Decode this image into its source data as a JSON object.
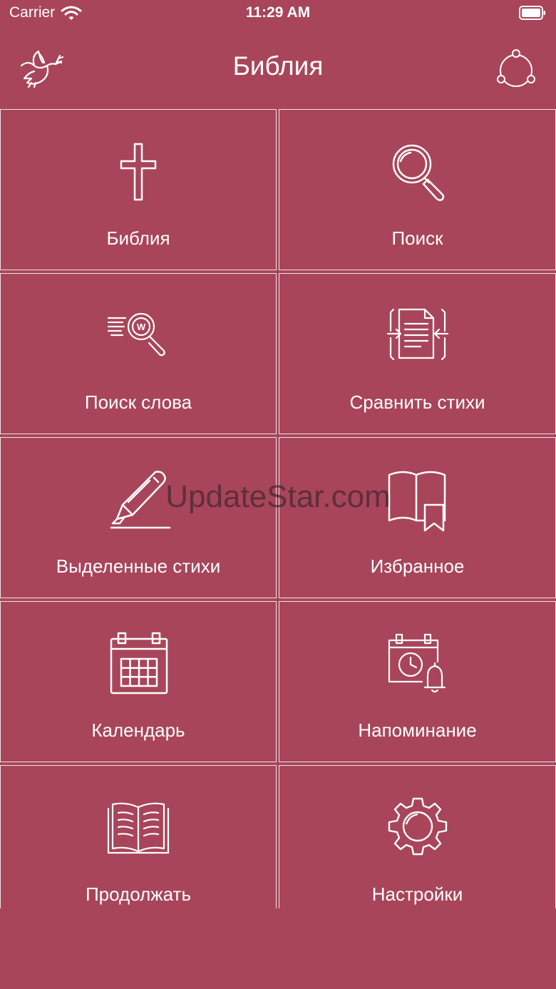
{
  "status_bar": {
    "carrier": "Carrier",
    "time": "11:29 AM"
  },
  "nav": {
    "title": "Библия",
    "left_icon": "dove-icon",
    "right_icon": "share-icon"
  },
  "tiles": [
    {
      "label": "Библия",
      "icon": "cross-icon"
    },
    {
      "label": "Поиск",
      "icon": "magnifier-icon"
    },
    {
      "label": "Поиск слова",
      "icon": "word-search-icon"
    },
    {
      "label": "Сравнить стихи",
      "icon": "compare-document-icon"
    },
    {
      "label": "Выделенные стихи",
      "icon": "highlighter-icon"
    },
    {
      "label": "Избранное",
      "icon": "bookmark-book-icon"
    },
    {
      "label": "Календарь",
      "icon": "calendar-icon"
    },
    {
      "label": "Напоминание",
      "icon": "reminder-icon"
    },
    {
      "label": "Продолжать",
      "icon": "open-book-icon"
    },
    {
      "label": "Настройки",
      "icon": "gear-icon"
    }
  ],
  "watermark": "UpdateStar.com",
  "colors": {
    "background": "#A8455A",
    "border": "#FFFFFF",
    "text": "#FFFFFF"
  }
}
